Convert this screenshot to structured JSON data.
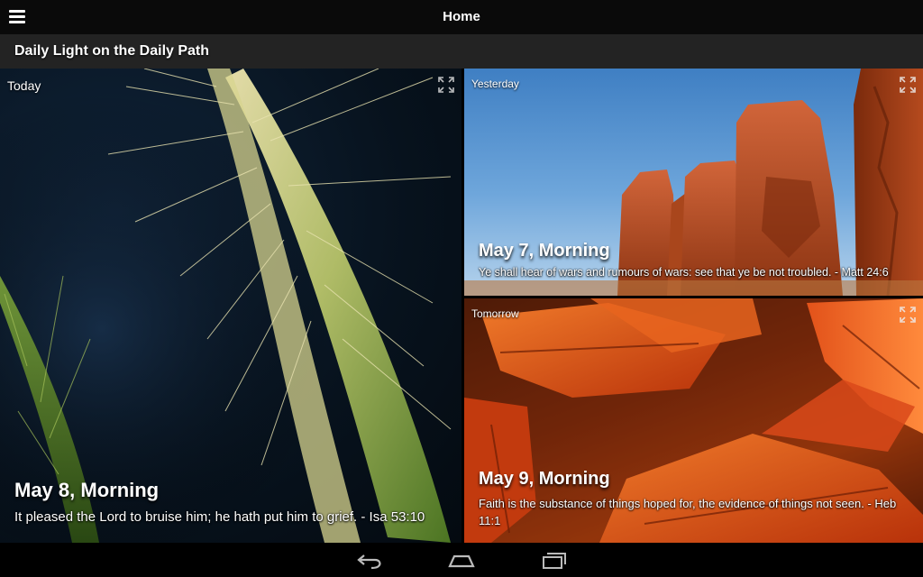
{
  "action_bar": {
    "title": "Home",
    "menu_icon": "hamburger-menu-icon"
  },
  "header": {
    "title": "Daily Light on the Daily Path"
  },
  "tiles": {
    "today": {
      "label": "Today",
      "title": "May 8, Morning",
      "text": "It pleased the Lord to bruise him; he hath put him to grief. - Isa 53:10",
      "icon": "expand-icon"
    },
    "yesterday": {
      "label": "Yesterday",
      "title": "May 7, Morning",
      "text": "Ye shall hear of wars and rumours of wars: see that ye be not troubled. - Matt 24:6",
      "icon": "expand-icon"
    },
    "tomorrow": {
      "label": "Tomorrow",
      "title": "May 9, Morning",
      "text": "Faith is the substance of things hoped for, the evidence of things not seen. - Heb 11:1",
      "icon": "expand-icon"
    }
  },
  "nav_bar": {
    "back_icon": "back-icon",
    "home_icon": "home-icon",
    "recent_icon": "recent-apps-icon"
  },
  "colors": {
    "action_bar": "#0a0a0a",
    "subheader": "#232323"
  }
}
